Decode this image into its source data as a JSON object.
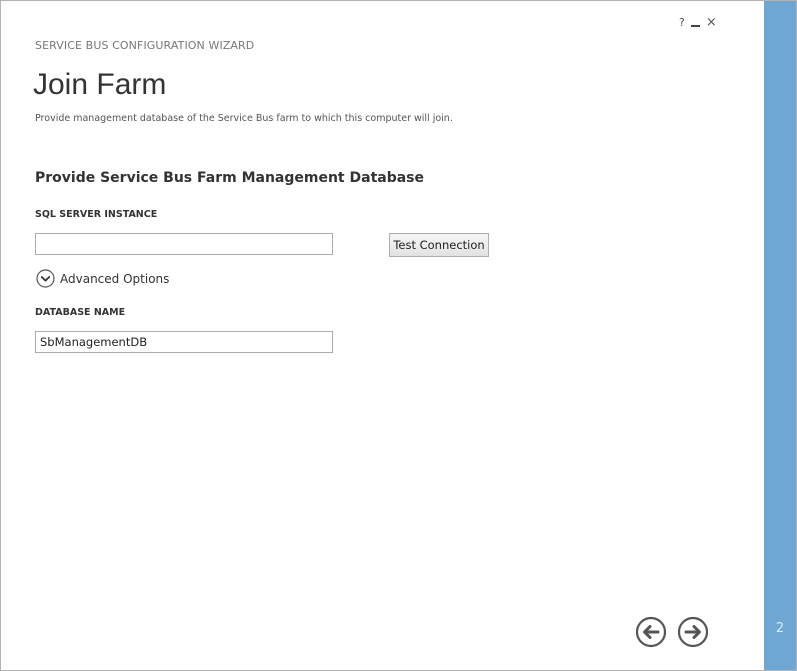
{
  "window": {
    "help_glyph": "?",
    "close_glyph": "×",
    "step_number": "2"
  },
  "header": {
    "wizard_title": "SERVICE BUS CONFIGURATION WIZARD",
    "page_title": "Join Farm",
    "description": "Provide management database of the Service Bus farm to which this computer will join."
  },
  "form": {
    "section_heading": "Provide Service Bus Farm Management Database",
    "sql_label": "SQL SERVER INSTANCE",
    "sql_value": "",
    "test_connection_label": "Test Connection",
    "advanced_options_label": "Advanced Options",
    "db_label": "DATABASE NAME",
    "db_value": "SbManagementDB"
  },
  "icons": {
    "help": "help-icon",
    "minimize": "minimize-icon",
    "close": "close-icon",
    "advanced": "chevron-down-circle-icon",
    "back": "arrow-left-circle-icon",
    "next": "arrow-right-circle-icon"
  },
  "colors": {
    "side_panel": "#6ea7d2",
    "nav_icon": "#555555"
  }
}
